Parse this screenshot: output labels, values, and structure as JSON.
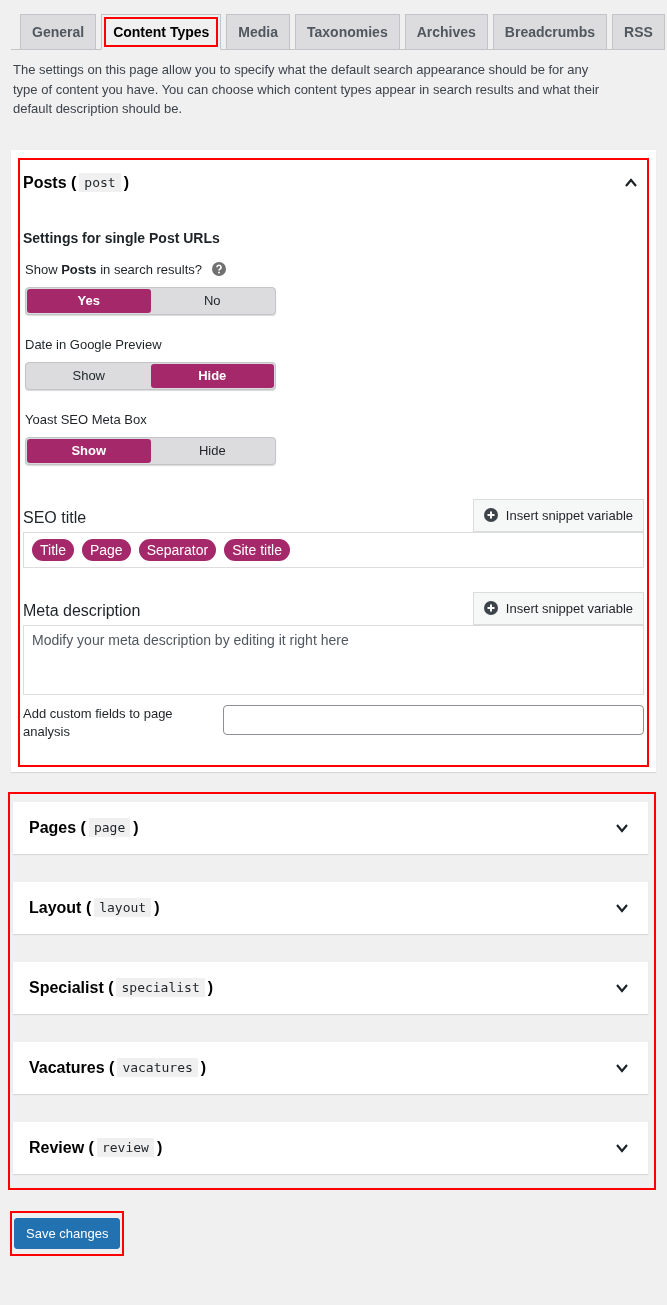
{
  "tabs": [
    {
      "label": "General",
      "selected": false,
      "highlighted": false
    },
    {
      "label": "Content Types",
      "selected": true,
      "highlighted": true
    },
    {
      "label": "Media",
      "selected": false,
      "highlighted": false
    },
    {
      "label": "Taxonomies",
      "selected": false,
      "highlighted": false
    },
    {
      "label": "Archives",
      "selected": false,
      "highlighted": false
    },
    {
      "label": "Breadcrumbs",
      "selected": false,
      "highlighted": false
    },
    {
      "label": "RSS",
      "selected": false,
      "highlighted": false
    }
  ],
  "intro": "The settings on this page allow you to specify what the default search appearance should be for any type of content you have. You can choose which content types appear in search results and what their default description should be.",
  "posts_panel": {
    "title": "Posts (",
    "slug": "post",
    "title_end": ")",
    "expanded": true,
    "highlighted": true,
    "heading": "Settings for single Post URLs",
    "toggles": [
      {
        "label": "Show **Posts** in search results?",
        "help": true,
        "options": [
          {
            "label": "Yes",
            "selected": true
          },
          {
            "label": "No",
            "selected": false
          }
        ]
      },
      {
        "label": "Date in Google Preview",
        "help": false,
        "options": [
          {
            "label": "Show",
            "selected": false
          },
          {
            "label": "Hide",
            "selected": true
          }
        ]
      },
      {
        "label": "Yoast SEO Meta Box",
        "help": false,
        "options": [
          {
            "label": "Show",
            "selected": true
          },
          {
            "label": "Hide",
            "selected": false
          }
        ]
      }
    ],
    "seo_title": {
      "label": "SEO title",
      "button": "Insert snippet variable",
      "tags": [
        "Title",
        "Page",
        "Separator",
        "Site title"
      ]
    },
    "meta_description": {
      "label": "Meta description",
      "button": "Insert snippet variable",
      "placeholder": "Modify your meta description by editing it right here"
    },
    "custom_fields": {
      "label": "Add custom fields to page analysis"
    }
  },
  "other_panels": {
    "highlighted": true,
    "items": [
      {
        "title": "Pages (",
        "slug": "page",
        "title_end": ")",
        "expanded": false
      },
      {
        "title": "Layout (",
        "slug": "layout",
        "title_end": ")",
        "expanded": false
      },
      {
        "title": "Specialist (",
        "slug": "specialist",
        "title_end": ")",
        "expanded": false
      },
      {
        "title": "Vacatures (",
        "slug": "vacatures",
        "title_end": ")",
        "expanded": false
      },
      {
        "title": "Review (",
        "slug": "review",
        "title_end": ")",
        "expanded": false
      }
    ]
  },
  "save_button": {
    "label": "Save changes",
    "highlighted": true
  }
}
